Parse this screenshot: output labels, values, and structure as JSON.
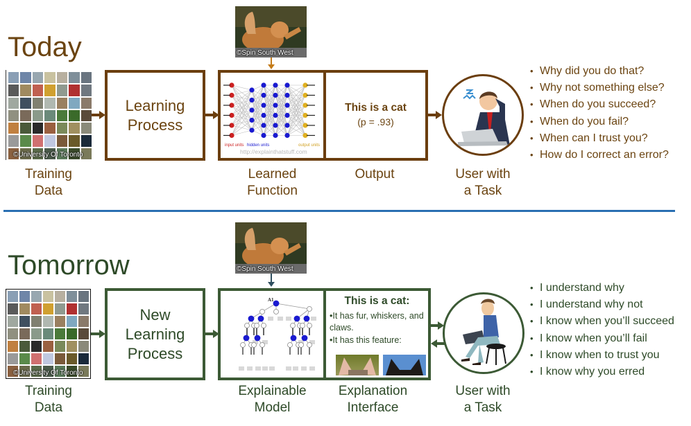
{
  "today": {
    "title": "Today",
    "input_image_credit": "©Spin South West",
    "training_data_credit": "©University Of Toronto",
    "training_data_label": [
      "Training",
      "Data"
    ],
    "learning_box_text": [
      "Learning",
      "Process"
    ],
    "learned_function_credit": "http://explainthatstuff.com",
    "nn_layer_labels": [
      "input units",
      "hidden units",
      "output units"
    ],
    "learned_function_label": [
      "Learned",
      "Function"
    ],
    "output_title": "This is a cat",
    "output_probability": "(p = .93)",
    "output_label": "Output",
    "user_label": [
      "User with",
      "a Task"
    ],
    "questions": [
      "Why did you do that?",
      "Why not something else?",
      "When do you succeed?",
      "When do you fail?",
      "When can I trust you?",
      "How do I correct an error?"
    ],
    "accent_color": "#6b3e0e"
  },
  "tomorrow": {
    "title": "Tomorrow",
    "input_image_credit": "©Spin South West",
    "training_data_credit": "©University Of Toronto",
    "training_data_label": [
      "Training",
      "Data"
    ],
    "learning_box_text": [
      "New",
      "Learning",
      "Process"
    ],
    "tree_root_label": "A1",
    "explainable_model_label": [
      "Explainable",
      "Model"
    ],
    "explanation_title": "This is a cat:",
    "explanation_bullets": [
      "It has fur, whiskers, and claws.",
      "It has this feature:"
    ],
    "explanation_label": [
      "Explanation",
      "Interface"
    ],
    "user_label": [
      "User with",
      "a Task"
    ],
    "statements": [
      "I understand why",
      "I understand why not",
      "I know when you’ll succeed",
      "I know when you’ll fail",
      "I know when to trust you",
      "I know why you erred"
    ],
    "accent_color": "#3c5a35"
  },
  "divider_color": "#2a6fb2"
}
